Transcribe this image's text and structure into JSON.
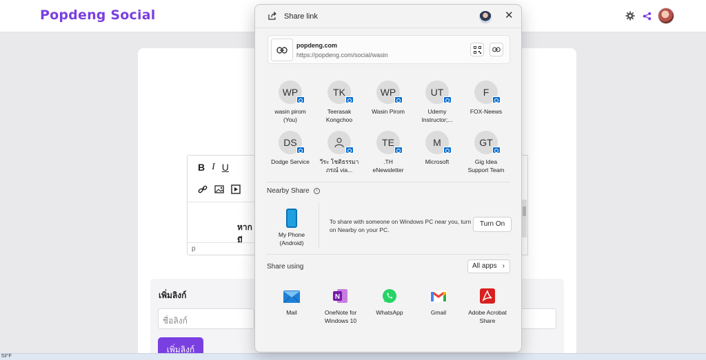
{
  "navbar": {
    "brand": "Popdeng Social"
  },
  "editor": {
    "body_text": "หากมี",
    "path": "p"
  },
  "link_panel": {
    "title": "เพิ่มลิงก์",
    "input_placeholder": "ชื่อลิงก์",
    "button": "เพิ่มลิงก์"
  },
  "taskbar": {
    "label": "53°F"
  },
  "share": {
    "title": "Share link",
    "link": {
      "domain": "popdeng.com",
      "url": "https://popdeng.com/social/wasin"
    },
    "contacts": [
      {
        "initials": "WP",
        "name_line1": "wasin pirom",
        "name_line2": "(You)"
      },
      {
        "initials": "TK",
        "name_line1": "Teerasak",
        "name_line2": "Kongchoo"
      },
      {
        "initials": "WP",
        "name_line1": "Wasin Pirom",
        "name_line2": ""
      },
      {
        "initials": "UT",
        "name_line1": "Udemy",
        "name_line2": "Instructor;..."
      },
      {
        "initials": "F",
        "name_line1": "FOX-Neews",
        "name_line2": ""
      },
      {
        "initials": "DS",
        "name_line1": "Dodge Service",
        "name_line2": ""
      },
      {
        "initials": "",
        "name_line1": "วีระ โชติธรรมา",
        "name_line2": "ภรณ์ via..."
      },
      {
        "initials": "TE",
        "name_line1": ".TH",
        "name_line2": "eNewsletter"
      },
      {
        "initials": "M",
        "name_line1": "Microsoft",
        "name_line2": ""
      },
      {
        "initials": "GT",
        "name_line1": "Gig Idea",
        "name_line2": "Support Team"
      }
    ],
    "nearby": {
      "title": "Nearby Share",
      "device_line1": "My Phone",
      "device_line2": "(Android)",
      "description": "To share with someone on Windows PC near you, turn on Nearby on your PC.",
      "button": "Turn On"
    },
    "share_using": {
      "title": "Share using",
      "all_apps": "All apps",
      "apps": [
        {
          "name_line1": "Mail",
          "name_line2": "",
          "icon": "mail-icon"
        },
        {
          "name_line1": "OneNote for",
          "name_line2": "Windows 10",
          "icon": "onenote-icon"
        },
        {
          "name_line1": "WhatsApp",
          "name_line2": "",
          "icon": "whatsapp-icon"
        },
        {
          "name_line1": "Gmail",
          "name_line2": "",
          "icon": "gmail-icon"
        },
        {
          "name_line1": "Adobe Acrobat",
          "name_line2": "Share",
          "icon": "acrobat-icon"
        }
      ]
    }
  }
}
